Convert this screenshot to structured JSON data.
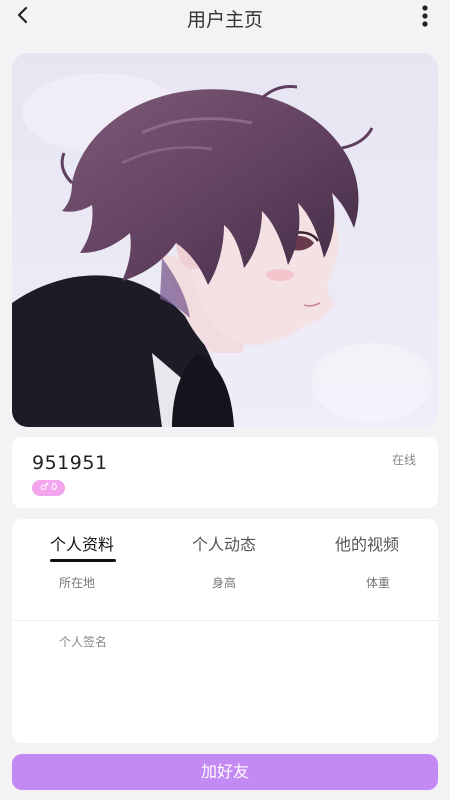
{
  "header": {
    "title": "用户主页"
  },
  "profile": {
    "username": "951951",
    "gender_symbol": "♂",
    "badge_value": "0",
    "status": "在线",
    "badge_color": "#f3a5ee"
  },
  "tabs": [
    {
      "label": "个人资料",
      "active": true
    },
    {
      "label": "个人动态",
      "active": false
    },
    {
      "label": "他的视频",
      "active": false
    }
  ],
  "details": {
    "fields": [
      "所在地",
      "身高",
      "体重"
    ],
    "signature_label": "个人签名"
  },
  "actions": {
    "add_friend_label": "加好友",
    "add_friend_color": "#c38af4"
  },
  "icons": {
    "back": "chevron-left-icon",
    "more": "more-vertical-icon"
  }
}
